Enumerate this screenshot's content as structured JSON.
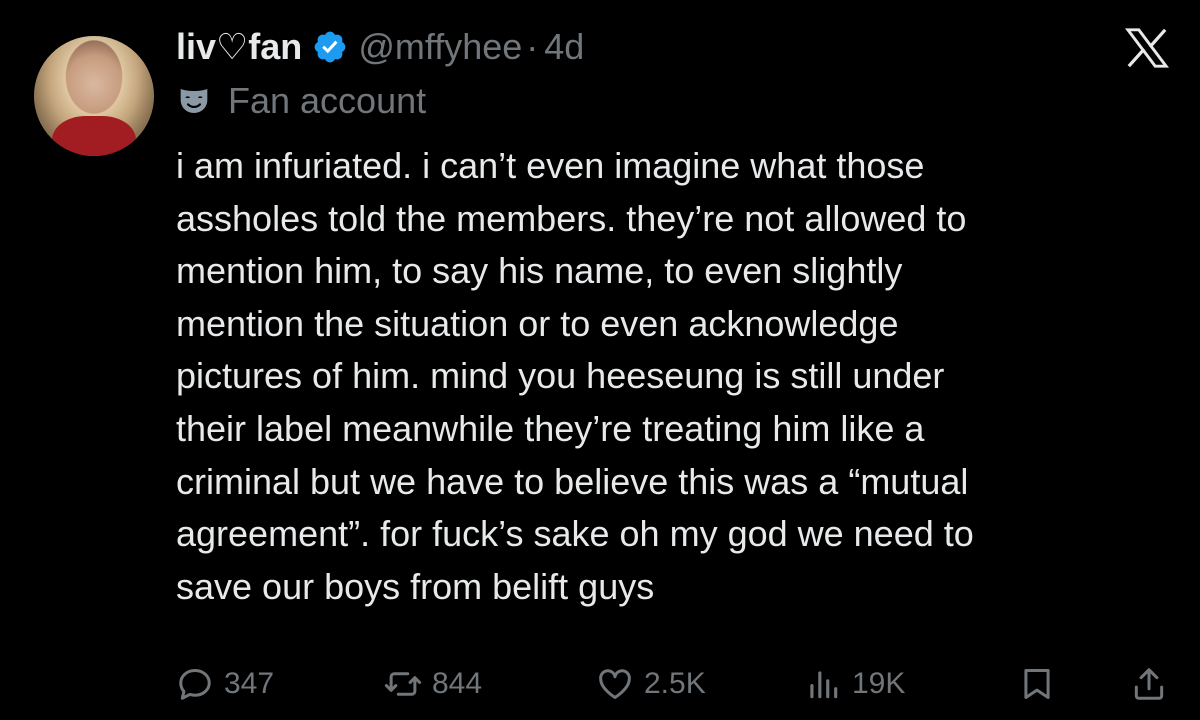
{
  "tweet": {
    "display_name": "liv♡fan",
    "handle": "@mffyhee",
    "separator": "·",
    "time": "4d",
    "label": "Fan account",
    "body_lines": [
      "i am infuriated. i can’t even imagine what those",
      "assholes told the members. they’re not allowed to",
      "mention him, to say his name, to even slightly",
      "mention the situation or to even acknowledge",
      "pictures of him. mind you heeseung is still under",
      "their label meanwhile they’re treating him like a",
      "criminal but we have to believe this was a “mutual",
      "agreement”. for fuck’s sake oh my god we need to",
      "save our boys from belift guys"
    ]
  },
  "actions": {
    "replies": "347",
    "reposts": "844",
    "likes": "2.5K",
    "views": "19K"
  },
  "icons": {
    "verified": "verified-badge-icon",
    "brand": "x-logo-icon",
    "label": "fan-mask-icon",
    "reply": "reply-icon",
    "repost": "repost-icon",
    "like": "heart-icon",
    "views": "views-icon",
    "bookmark": "bookmark-icon",
    "share": "share-icon"
  },
  "colors": {
    "background": "#000000",
    "text": "#e7e9ea",
    "muted": "#71767b",
    "verified": "#1d9bf0"
  }
}
